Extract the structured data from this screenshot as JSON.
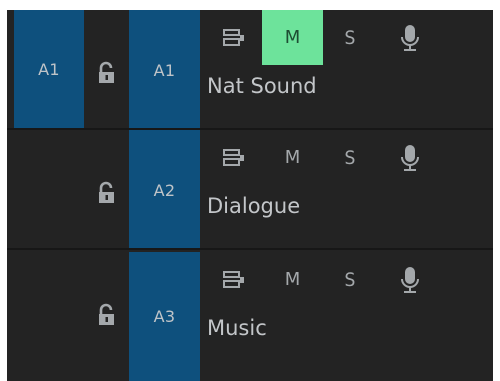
{
  "tracks": [
    {
      "source_label": "A1",
      "target_label": "A1",
      "name": "Nat Sound",
      "mute_label": "M",
      "solo_label": "S",
      "mute_active": true,
      "lock_icon": "lock-open-icon",
      "sync_icon": "sync-lock-icon",
      "voiceover_icon": "microphone-icon"
    },
    {
      "source_label": "",
      "target_label": "A2",
      "name": "Dialogue",
      "mute_label": "M",
      "solo_label": "S",
      "mute_active": false,
      "lock_icon": "lock-open-icon",
      "sync_icon": "sync-lock-icon",
      "voiceover_icon": "microphone-icon"
    },
    {
      "source_label": "",
      "target_label": "A3",
      "name": "Music",
      "mute_label": "M",
      "solo_label": "S",
      "mute_active": false,
      "lock_icon": "lock-open-icon",
      "sync_icon": "sync-lock-icon",
      "voiceover_icon": "microphone-icon"
    }
  ],
  "colors": {
    "panel_bg": "#232323",
    "track_target": "#0e507d",
    "mute_active": "#6de39b",
    "icon_gray": "#a4a8ab"
  }
}
